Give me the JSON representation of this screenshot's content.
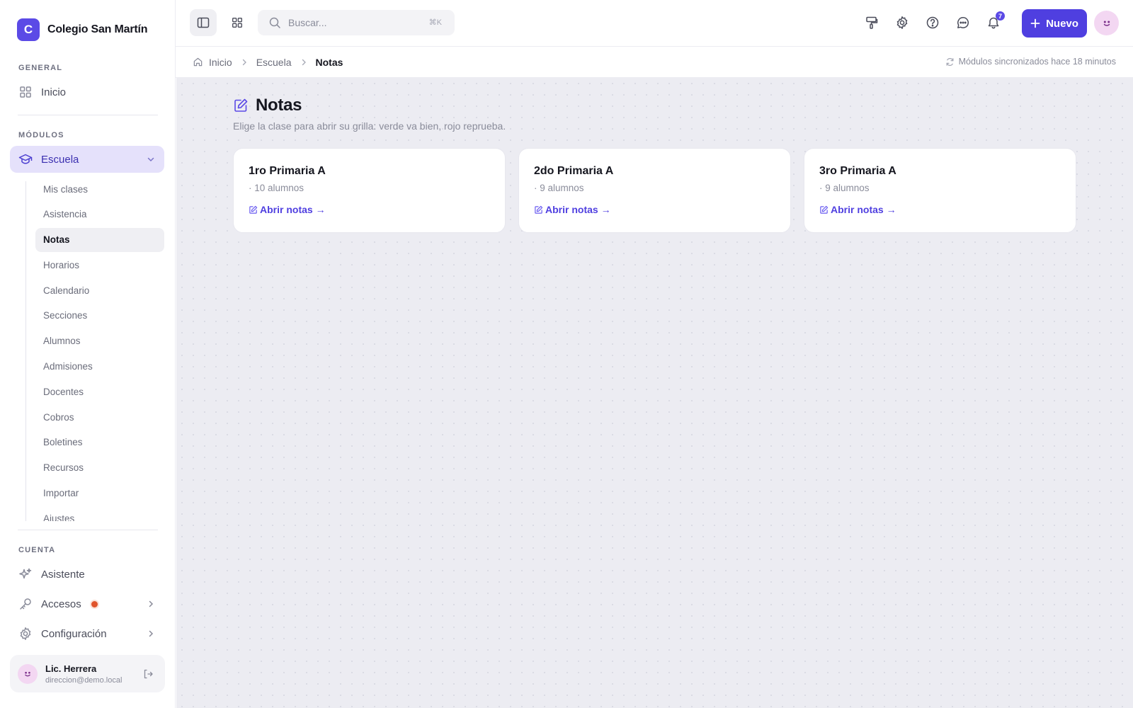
{
  "brand": {
    "initial": "C",
    "name": "Colegio San Martín"
  },
  "sidebar": {
    "general_label": "GENERAL",
    "home_label": "Inicio",
    "modules_label": "MÓDULOS",
    "school_label": "Escuela",
    "sub_items": [
      "Mis clases",
      "Asistencia",
      "Notas",
      "Horarios",
      "Calendario",
      "Secciones",
      "Alumnos",
      "Admisiones",
      "Docentes",
      "Cobros",
      "Boletines",
      "Recursos",
      "Importar",
      "Ajustes"
    ],
    "active_sub": "Notas",
    "account_label": "CUENTA",
    "assistant_label": "Asistente",
    "access_label": "Accesos",
    "config_label": "Configuración"
  },
  "user": {
    "name": "Lic. Herrera",
    "email": "direccion@demo.local"
  },
  "topbar": {
    "search_placeholder": "Buscar...",
    "search_shortcut": "⌘K",
    "notifications_count": "7",
    "new_label": "Nuevo"
  },
  "breadcrumb": {
    "home": "Inicio",
    "section": "Escuela",
    "current": "Notas"
  },
  "sync_status": "Módulos sincronizados hace 18 minutos",
  "page": {
    "title": "Notas",
    "subtitle": "Elige la clase para abrir su grilla: verde va bien, rojo reprueba."
  },
  "classes": [
    {
      "name": "1ro Primaria A",
      "meta": "· 10 alumnos",
      "link": "Abrir notas →"
    },
    {
      "name": "2do Primaria A",
      "meta": "· 9 alumnos",
      "link": "Abrir notas →"
    },
    {
      "name": "3ro Primaria A",
      "meta": "· 9 alumnos",
      "link": "Abrir notas →"
    }
  ],
  "colors": {
    "accent": "#4f3fe0",
    "active_nav_bg": "#e5e1fb",
    "status_dot": "#e0542b"
  }
}
